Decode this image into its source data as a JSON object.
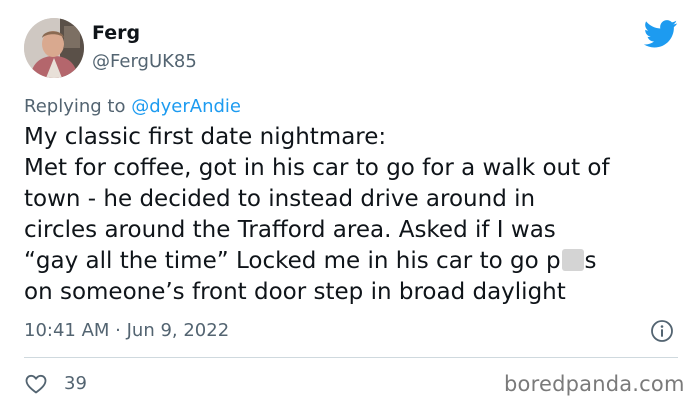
{
  "author": {
    "display_name": "Ferg",
    "handle": "@FergUK85"
  },
  "reply": {
    "prefix": "Replying to",
    "mention": "@dyerAndie"
  },
  "tweet": {
    "lines": [
      "My classic first date nightmare:",
      "Met for coffee, got in his car to go for a walk out of",
      "town - he decided to instead drive around in",
      "circles around the Trafford area. Asked if I was",
      "on someone’s front door step in broad daylight"
    ],
    "line5_before": "“gay all the time” Locked me in his car to go p",
    "line5_after": "s"
  },
  "meta": {
    "timestamp": "10:41 AM · Jun 9, 2022"
  },
  "actions": {
    "likes": "39"
  },
  "watermark": "boredpanda.com",
  "colors": {
    "accent": "#1d9bf0",
    "secondary_text": "#536471",
    "divider": "#cfd9de"
  },
  "icons": [
    "twitter-bird-icon",
    "info-icon",
    "heart-icon"
  ]
}
